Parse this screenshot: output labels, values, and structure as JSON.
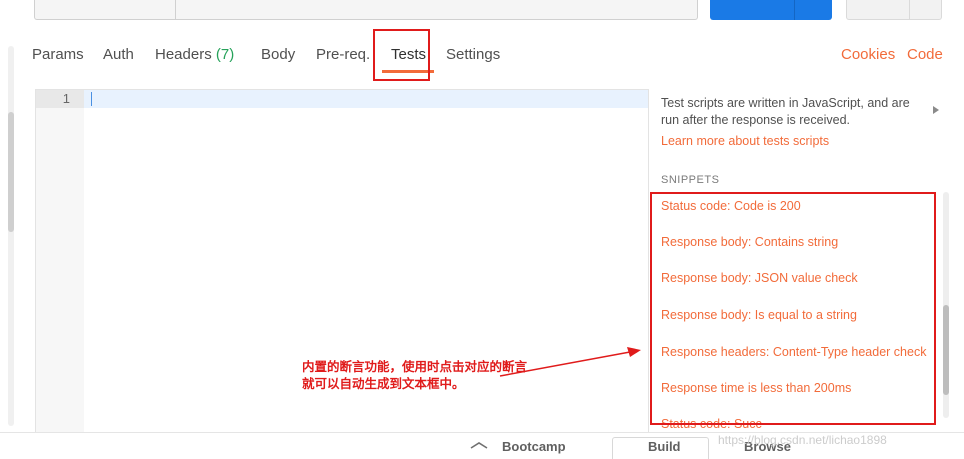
{
  "tabs": [
    {
      "label": "Params"
    },
    {
      "label": "Auth"
    },
    {
      "label": "Headers",
      "count": "(7)"
    },
    {
      "label": "Body"
    },
    {
      "label": "Pre-req."
    },
    {
      "label": "Tests"
    },
    {
      "label": "Settings"
    }
  ],
  "links": {
    "cookies": "Cookies",
    "code": "Code"
  },
  "editor": {
    "line_number": "1"
  },
  "panel": {
    "description": "Test scripts are written in JavaScript, and are run after the response is received.",
    "learn_more": "Learn more about tests scripts",
    "snippets_heading": "SNIPPETS",
    "snippets": [
      "Status code: Code is 200",
      "Response body: Contains string",
      "Response body: JSON value check",
      "Response body: Is equal to a string",
      "Response headers: Content-Type header check",
      "Response time is less than 200ms",
      "Status code: Succ"
    ]
  },
  "annotation": {
    "line1": "内置的断言功能，使用时点击对应的断言",
    "line2": "就可以自动生成到文本框中。"
  },
  "statusbar": {
    "bootcamp": "Bootcamp",
    "build": "Build",
    "browse": "Browse"
  },
  "watermark": "https://blog.csdn.net/lichao1898",
  "colors": {
    "accent": "#f26b3a",
    "annotation_red": "#e01b1b",
    "send_blue": "#1a7ae6",
    "count_green": "#26a25a"
  }
}
